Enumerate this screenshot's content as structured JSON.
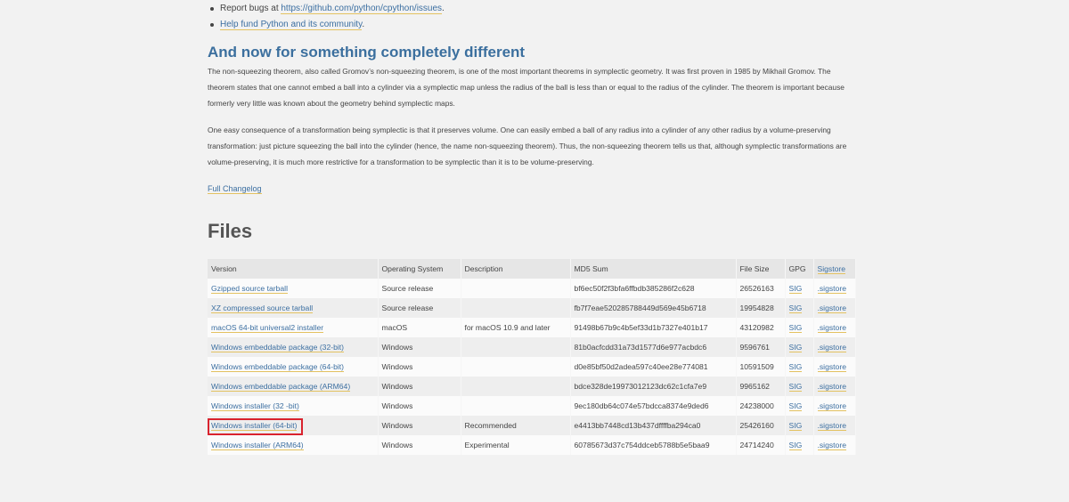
{
  "bullets": [
    {
      "prefix": "Report bugs at ",
      "link": "https://github.com/python/cpython/issues",
      "suffix": "."
    },
    {
      "prefix": "",
      "link": "Help fund Python and its community",
      "suffix": "."
    }
  ],
  "section": {
    "heading": "And now for something completely different",
    "paragraphs": [
      "The non-squeezing theorem, also called Gromov’s non-squeezing theorem, is one of the most important theorems in symplectic geometry. It was first proven in 1985 by Mikhail Gromov. The theorem states that one cannot embed a ball into a cylinder via a symplectic map unless the radius of the ball is less than or equal to the radius of the cylinder. The theorem is important because formerly very little was known about the geometry behind symplectic maps.",
      "One easy consequence of a transformation being symplectic is that it preserves volume. One can easily embed a ball of any radius into a cylinder of any other radius by a volume-preserving transformation: just picture squeezing the ball into the cylinder (hence, the name non-squeezing theorem). Thus, the non-squeezing theorem tells us that, although symplectic transformations are volume-preserving, it is much more restrictive for a transformation to be symplectic than it is to be volume-preserving."
    ]
  },
  "changelog_link": "Full Changelog",
  "files": {
    "heading": "Files",
    "columns": [
      "Version",
      "Operating System",
      "Description",
      "MD5 Sum",
      "File Size",
      "GPG",
      "Sigstore"
    ],
    "rows": [
      {
        "version": "Gzipped source tarball",
        "os": "Source release",
        "description": "",
        "md5": "bf6ec50f2f3bfa6ffbdb385286f2c628",
        "size": "26526163",
        "gpg": "SIG",
        "sigstore": ".sigstore"
      },
      {
        "version": "XZ compressed source tarball",
        "os": "Source release",
        "description": "",
        "md5": "fb7f7eae520285788449d569e45b6718",
        "size": "19954828",
        "gpg": "SIG",
        "sigstore": ".sigstore"
      },
      {
        "version": "macOS 64-bit universal2 installer",
        "os": "macOS",
        "description": "for macOS 10.9 and later",
        "md5": "91498b67b9c4b5ef33d1b7327e401b17",
        "size": "43120982",
        "gpg": "SIG",
        "sigstore": ".sigstore"
      },
      {
        "version": "Windows embeddable package (32-bit)",
        "os": "Windows",
        "description": "",
        "md5": "81b0acfcdd31a73d1577d6e977acbdc6",
        "size": "9596761",
        "gpg": "SIG",
        "sigstore": ".sigstore"
      },
      {
        "version": "Windows embeddable package (64-bit)",
        "os": "Windows",
        "description": "",
        "md5": "d0e85bf50d2adea597c40ee28e774081",
        "size": "10591509",
        "gpg": "SIG",
        "sigstore": ".sigstore"
      },
      {
        "version": "Windows embeddable package (ARM64)",
        "os": "Windows",
        "description": "",
        "md5": "bdce328de19973012123dc62c1cfa7e9",
        "size": "9965162",
        "gpg": "SIG",
        "sigstore": ".sigstore"
      },
      {
        "version": "Windows installer (32 -bit)",
        "os": "Windows",
        "description": "",
        "md5": "9ec180db64c074e57bdcca8374e9ded6",
        "size": "24238000",
        "gpg": "SIG",
        "sigstore": ".sigstore"
      },
      {
        "version": "Windows installer (64-bit)",
        "os": "Windows",
        "description": "Recommended",
        "md5": "e4413bb7448cd13b437dffffba294ca0",
        "size": "25426160",
        "gpg": "SIG",
        "sigstore": ".sigstore"
      },
      {
        "version": "Windows installer (ARM64)",
        "os": "Windows",
        "description": "Experimental",
        "md5": "60785673d37c754ddceb5788b5e5baa9",
        "size": "24714240",
        "gpg": "SIG",
        "sigstore": ".sigstore"
      }
    ]
  },
  "colors": {
    "link": "#3c6fa1",
    "link_underline": "#e3c261",
    "heading": "#3b6f9e",
    "highlight": "#d9232e"
  }
}
